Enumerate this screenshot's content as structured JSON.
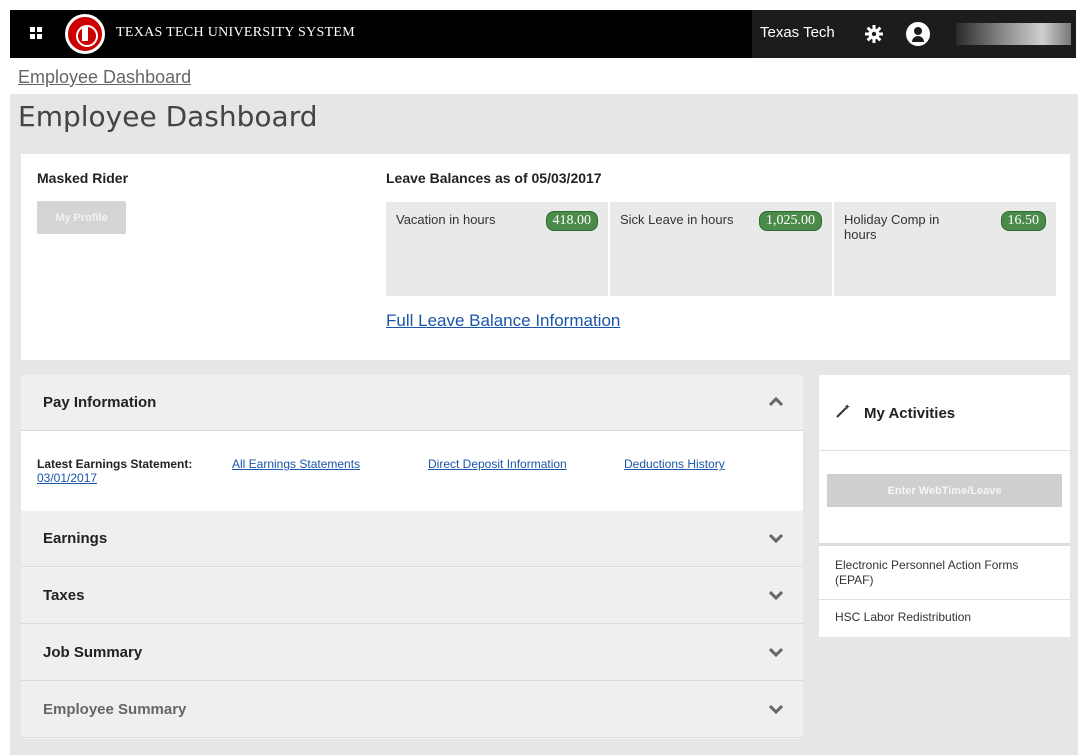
{
  "header": {
    "brand": "TEXAS TECH UNIVERSITY SYSTEM",
    "institution": "Texas Tech",
    "icons": {
      "apps": "apps-grid-icon",
      "seal": "university-seal-logo",
      "settings": "gear-icon",
      "user": "user-avatar-icon"
    }
  },
  "breadcrumb": {
    "current": "Employee Dashboard"
  },
  "page": {
    "title": "Employee Dashboard"
  },
  "profile": {
    "name": "Masked Rider",
    "profile_button": "My Profile"
  },
  "leave": {
    "title": "Leave Balances as of 05/03/2017",
    "items": [
      {
        "label": "Vacation in hours",
        "value": "418.00"
      },
      {
        "label": "Sick Leave in hours",
        "value": "1,025.00"
      },
      {
        "label": "Holiday Comp in hours",
        "value": "16.50"
      }
    ],
    "full_link": "Full Leave Balance Information",
    "badge_color": "#4a8b4a"
  },
  "pay": {
    "title": "Pay Information",
    "latest_label": "Latest Earnings Statement:",
    "latest_date": "03/01/2017",
    "links": [
      "All Earnings Statements",
      "Direct Deposit Information",
      "Deductions History"
    ],
    "sections": [
      "Earnings",
      "Taxes",
      "Job Summary",
      "Employee Summary"
    ]
  },
  "activities": {
    "title": "My Activities",
    "button": "Enter WebTime/Leave",
    "links": [
      "Electronic Personnel Action Forms (EPAF)",
      "HSC Labor Redistribution"
    ]
  },
  "colors": {
    "header_bg": "#000000",
    "link": "#1a56a8",
    "panel_bg": "#e6e6e6"
  }
}
